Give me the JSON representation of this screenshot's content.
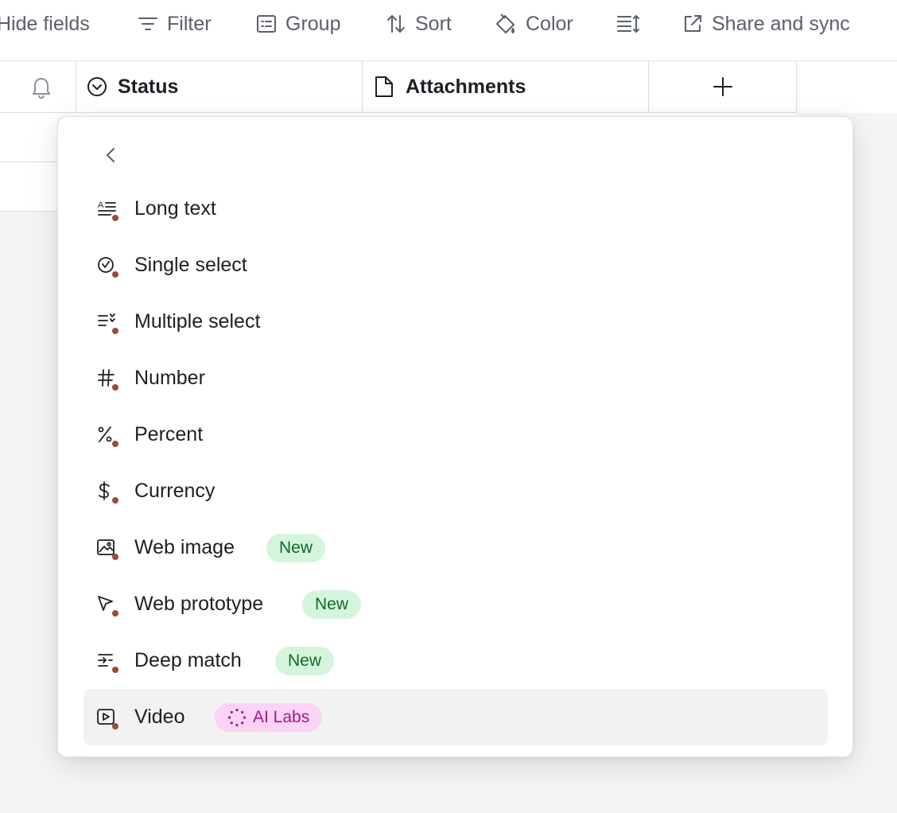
{
  "toolbar": {
    "hide_fields": "Hide fields",
    "filter": "Filter",
    "group": "Group",
    "sort": "Sort",
    "color": "Color",
    "share_sync": "Share and sync"
  },
  "columns": {
    "status": "Status",
    "attachments": "Attachments"
  },
  "menu": {
    "items": [
      {
        "label": "Long text",
        "icon": "long-text-icon"
      },
      {
        "label": "Single select",
        "icon": "single-select-icon"
      },
      {
        "label": "Multiple select",
        "icon": "multiple-select-icon"
      },
      {
        "label": "Number",
        "icon": "number-icon"
      },
      {
        "label": "Percent",
        "icon": "percent-icon"
      },
      {
        "label": "Currency",
        "icon": "currency-icon"
      },
      {
        "label": "Web image",
        "icon": "web-image-icon",
        "badge": "New"
      },
      {
        "label": "Web prototype",
        "icon": "web-prototype-icon",
        "badge": "New"
      },
      {
        "label": "Deep match",
        "icon": "deep-match-icon",
        "badge": "New"
      },
      {
        "label": "Video",
        "icon": "video-icon",
        "badge": "AI Labs",
        "highlighted": true
      }
    ]
  },
  "colors": {
    "icon_dot": "#9a4b36",
    "new_badge_bg": "#d4f5dc",
    "new_badge_text": "#0f6b27",
    "ai_badge_bg": "#fbd3f5",
    "ai_badge_text": "#a1178a",
    "highlight_bg": "#f2f2f3"
  }
}
